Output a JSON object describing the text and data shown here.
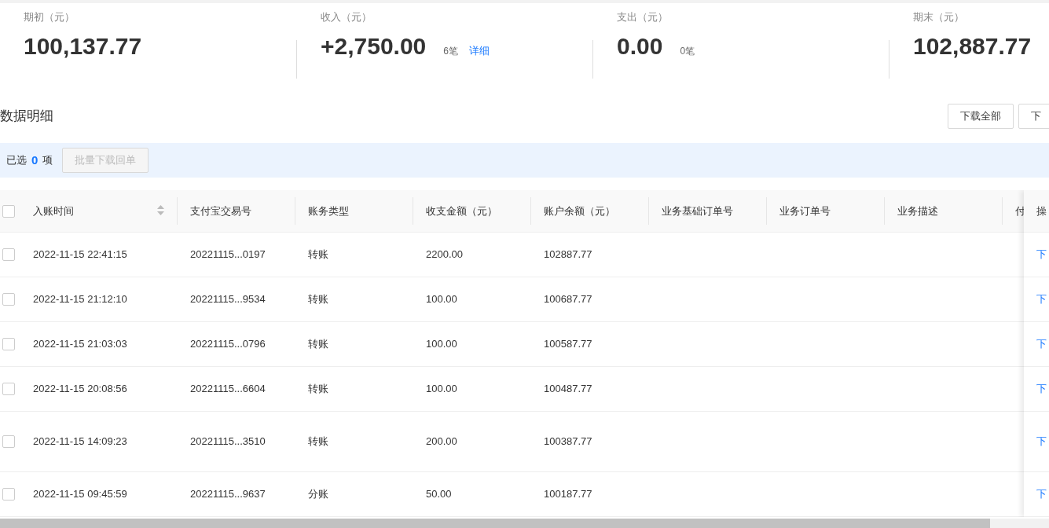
{
  "summary": [
    {
      "label": "期初（元）",
      "value": "100,137.77"
    },
    {
      "label": "收入（元）",
      "value": "+2,750.00",
      "count": "6笔",
      "link": "详细"
    },
    {
      "label": "支出（元）",
      "value": "0.00",
      "count": "0笔"
    },
    {
      "label": "期末（元）",
      "value": "102,887.77"
    }
  ],
  "section_title": "数据明细",
  "toolbar_buttons": [
    "下载全部",
    "下"
  ],
  "selection": {
    "prefix": "已选",
    "count": "0",
    "suffix": "项",
    "batch_button": {
      "label": "批量下载回单",
      "disabled": true
    }
  },
  "table": {
    "select_all": {
      "checked": false
    },
    "columns": [
      {
        "label": "入账时间",
        "sortable": true
      },
      {
        "label": "支付宝交易号",
        "sortable": false
      },
      {
        "label": "账务类型",
        "sortable": false
      },
      {
        "label": "收支金额（元）",
        "sortable": false
      },
      {
        "label": "账户余额（元）",
        "sortable": false
      },
      {
        "label": "业务基础订单号",
        "sortable": false
      },
      {
        "label": "业务订单号",
        "sortable": false
      },
      {
        "label": "业务描述",
        "sortable": false
      },
      {
        "label": "付",
        "sortable": false
      }
    ],
    "action_column": "操",
    "rows": [
      {
        "checked": false,
        "cells": [
          "2022-11-15 22:41:15",
          "20221115...0197",
          "转账",
          "2200.00",
          "102887.77"
        ],
        "action": "下"
      },
      {
        "checked": false,
        "cells": [
          "2022-11-15 21:12:10",
          "20221115...9534",
          "转账",
          "100.00",
          "100687.77"
        ],
        "action": "下"
      },
      {
        "checked": false,
        "cells": [
          "2022-11-15 21:03:03",
          "20221115...0796",
          "转账",
          "100.00",
          "100587.77"
        ],
        "action": "下"
      },
      {
        "checked": false,
        "cells": [
          "2022-11-15 20:08:56",
          "20221115...6604",
          "转账",
          "100.00",
          "100487.77"
        ],
        "action": "下"
      },
      {
        "checked": false,
        "cells": [
          "2022-11-15 14:09:23",
          "20221115...3510",
          "转账",
          "200.00",
          "100387.77"
        ],
        "action": "下"
      },
      {
        "checked": false,
        "cells": [
          "2022-11-15 09:45:59",
          "20221115...9637",
          "分账",
          "50.00",
          "100187.77"
        ],
        "action": "下"
      }
    ]
  }
}
